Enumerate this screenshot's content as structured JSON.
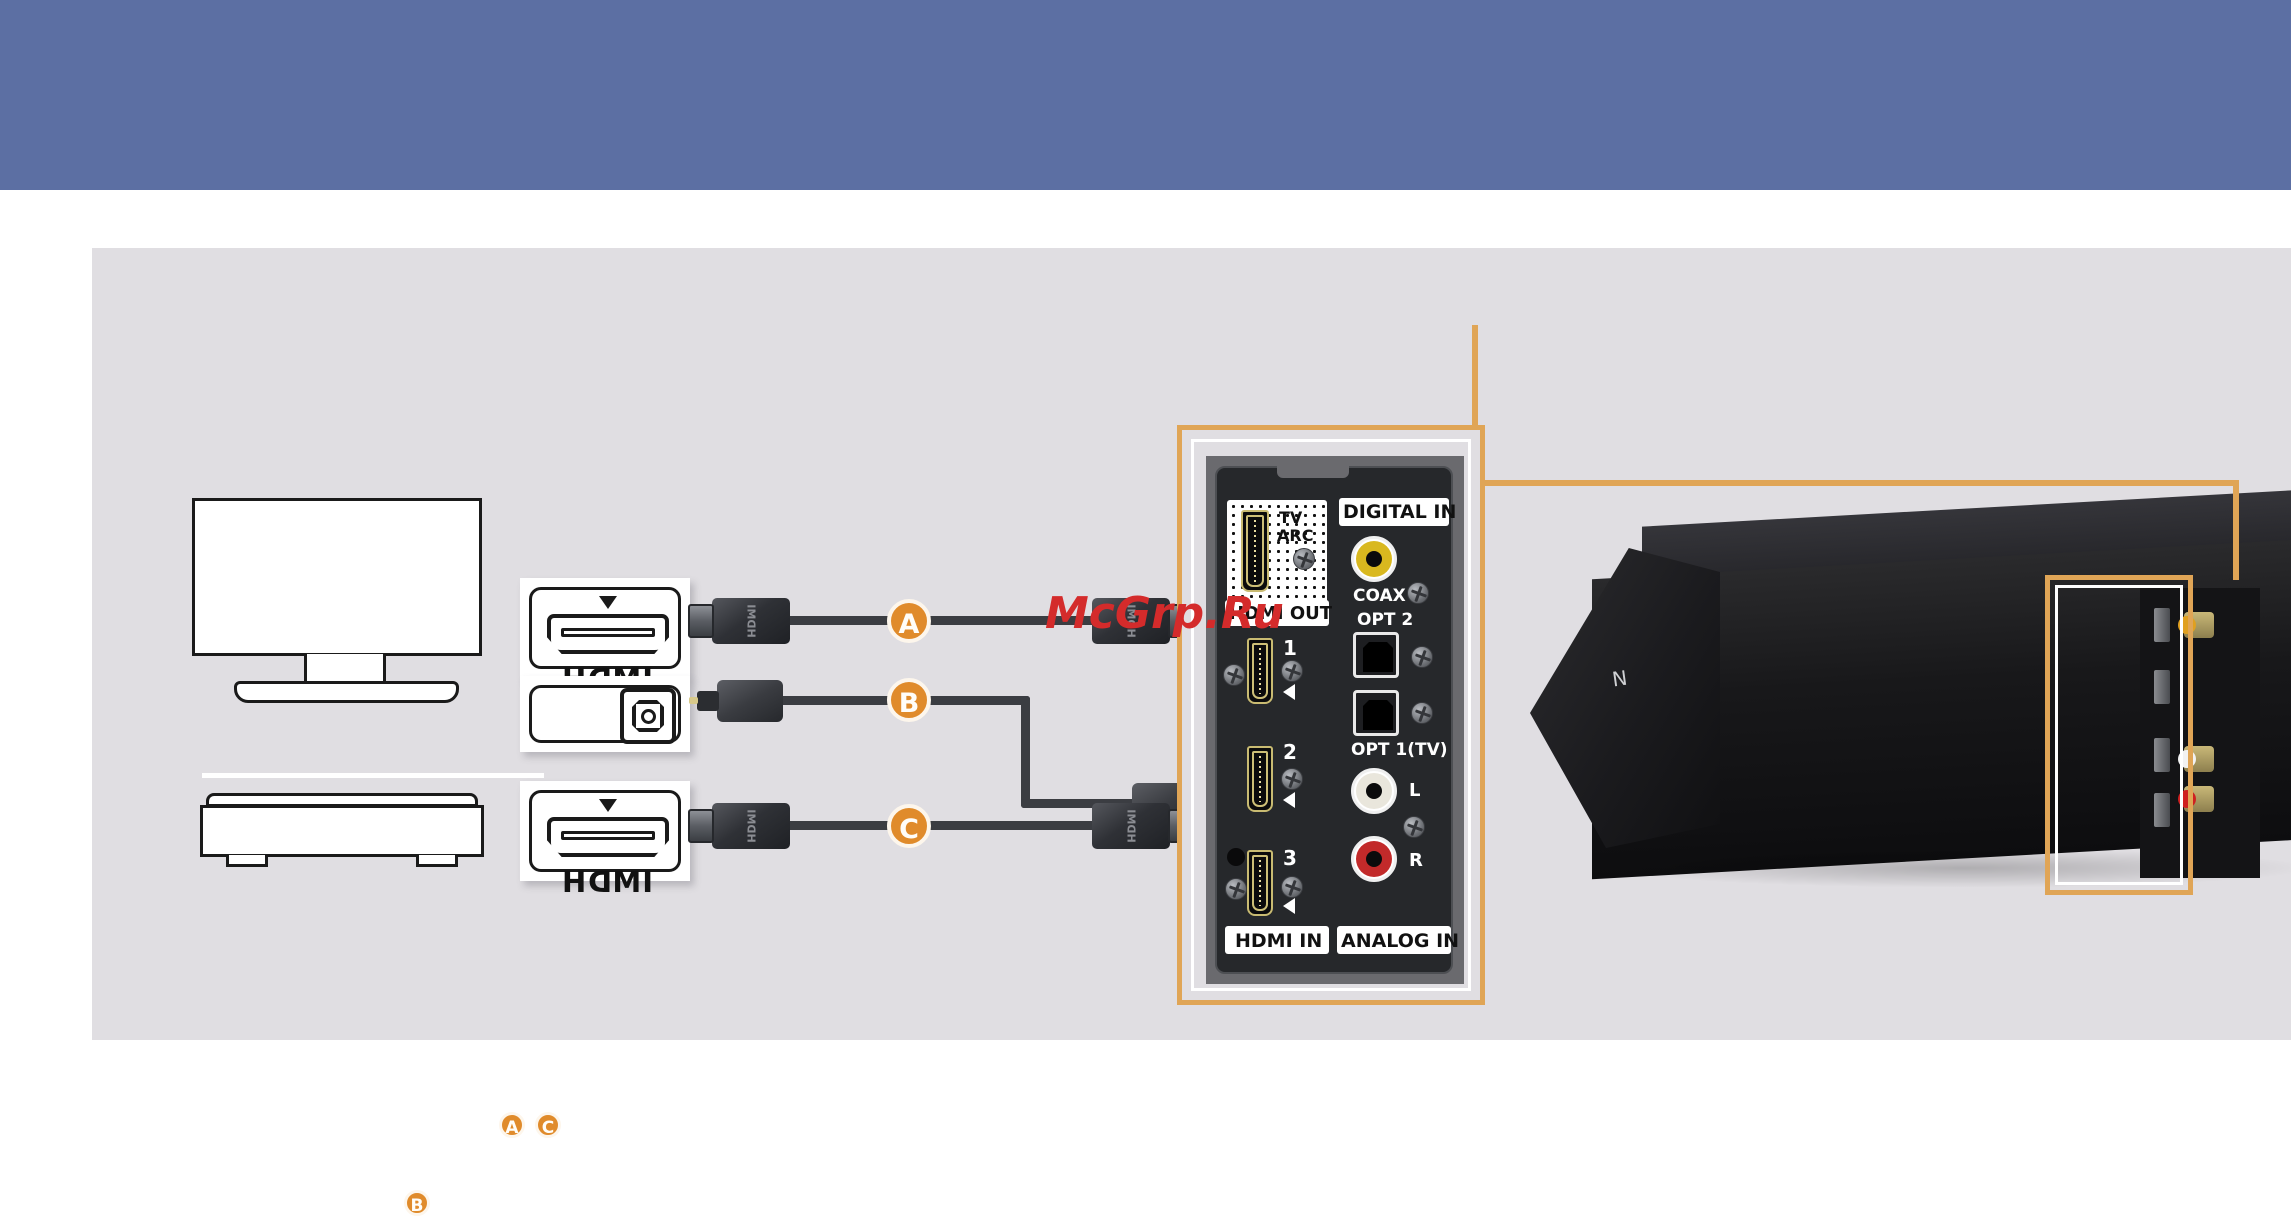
{
  "page": {
    "header_band_color": "#5c6fa3",
    "panel_bg_color": "#e0dee2",
    "accent_color": "#e0a556",
    "badge_color": "#e08b2b",
    "watermark": "McGrp.Ru"
  },
  "devices": {
    "tv": {
      "name": "TV",
      "icon": "television-icon"
    },
    "player": {
      "name": "Player",
      "icon": "disc-player-icon"
    }
  },
  "callouts": [
    {
      "id": "tv-hdmi",
      "port_label": "HDMI",
      "icon": "hdmi-port-icon",
      "has_arrow_marker": true
    },
    {
      "id": "tv-optical",
      "port_label": "",
      "icon": "optical-toslink-port-icon",
      "has_arrow_marker": false
    },
    {
      "id": "player-hdmi",
      "port_label": "HDMI",
      "icon": "hdmi-port-icon",
      "has_arrow_marker": true
    }
  ],
  "cables": [
    {
      "id": "A",
      "badge": "A",
      "type": "hdmi",
      "plug_label": "HDMI"
    },
    {
      "id": "B",
      "badge": "B",
      "type": "optical",
      "plug_label": ""
    },
    {
      "id": "C",
      "badge": "C",
      "type": "hdmi",
      "plug_label": "HDMI"
    }
  ],
  "connector_panel": {
    "hdmi_out": {
      "section_label": "HDMI OUT",
      "port_sub_label_line1": "TV",
      "port_sub_label_line2": "ARC"
    },
    "digital_in": {
      "section_label": "DIGITAL IN",
      "coax_label": "COAX",
      "opt2_label": "OPT 2",
      "opt1_label": "OPT 1(TV)"
    },
    "hdmi_in": {
      "section_label": "HDMI IN",
      "ports": [
        "1",
        "2",
        "3"
      ]
    },
    "analog_in": {
      "section_label": "ANALOG IN",
      "left_label": "L",
      "right_label": "R"
    }
  },
  "product": {
    "name": "Soundbar",
    "nfc_mark": "N"
  },
  "legend": {
    "row1": [
      "A",
      "C"
    ],
    "row2": [
      "B"
    ]
  }
}
